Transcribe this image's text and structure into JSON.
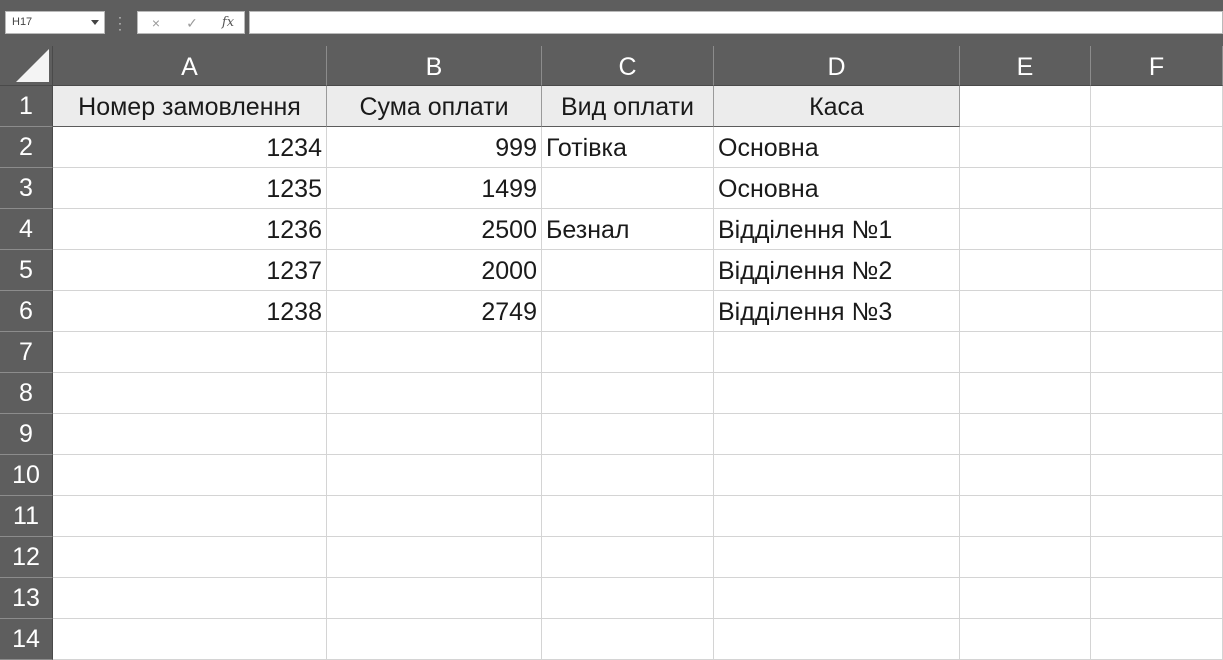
{
  "formula_bar": {
    "name_box": "H17",
    "cancel_icon": "×",
    "enter_icon": "✓",
    "fx_label": "fx",
    "formula": ""
  },
  "columns": [
    "A",
    "B",
    "C",
    "D",
    "E",
    "F"
  ],
  "rows": [
    "1",
    "2",
    "3",
    "4",
    "5",
    "6",
    "7",
    "8",
    "9",
    "10",
    "11",
    "12",
    "13",
    "14"
  ],
  "table": {
    "headers": [
      "Номер замовлення",
      "Сума оплати",
      "Вид оплати",
      "Каса"
    ],
    "rows": [
      [
        "1234",
        "999",
        "Готівка",
        "Основна"
      ],
      [
        "1235",
        "1499",
        "",
        "Основна"
      ],
      [
        "1236",
        "2500",
        "Безнал",
        "Відділення №1"
      ],
      [
        "1237",
        "2000",
        "",
        "Відділення №2"
      ],
      [
        "1238",
        "2749",
        "",
        "Відділення №3"
      ]
    ]
  },
  "colors": {
    "chrome": "#5e5e5e",
    "header_fill": "#ececec",
    "gridline": "#d4d4d4"
  }
}
